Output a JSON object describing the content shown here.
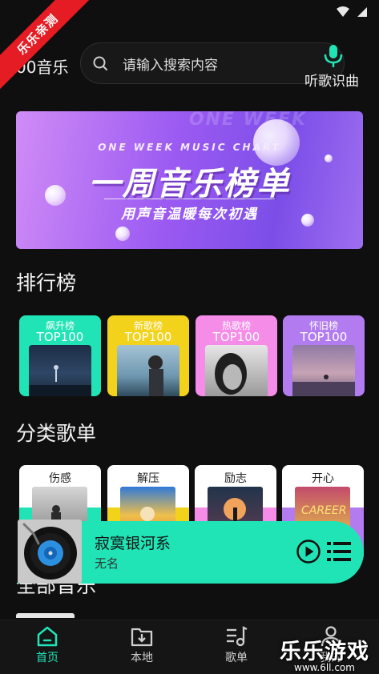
{
  "watermark": {
    "corner_ribbon": "乐乐亲测",
    "brand": "乐乐游戏",
    "url": "www.6ll.com"
  },
  "header": {
    "app_name": "00音乐",
    "search_placeholder": "请输入搜索内容",
    "recognize_label": "听歌识曲"
  },
  "banner": {
    "ghost_text": "ONE WEEK",
    "english_title": "ONE WEEK MUSIC CHART",
    "title": "一周音乐榜单",
    "subtitle": "用声音温暖每次初遇"
  },
  "rankings": {
    "title": "排行榜",
    "items": [
      {
        "name": "飙升榜",
        "tag": "TOP100",
        "color": "#21e4b6"
      },
      {
        "name": "新歌榜",
        "tag": "TOP100",
        "color": "#f3d21b"
      },
      {
        "name": "热歌榜",
        "tag": "TOP100",
        "color": "#f48ce8"
      },
      {
        "name": "怀旧榜",
        "tag": "TOP100",
        "color": "#b27cf0"
      }
    ]
  },
  "categories": {
    "title": "分类歌单",
    "items": [
      {
        "name": "伤感",
        "color": "#21e4b6"
      },
      {
        "name": "解压",
        "color": "#f3d21b"
      },
      {
        "name": "励志",
        "color": "#f48ce8"
      },
      {
        "name": "开心",
        "color": "#b27cf0"
      }
    ]
  },
  "all_music": {
    "title": "全部音乐"
  },
  "player": {
    "song": "寂寞银河系",
    "artist": "无名"
  },
  "nav": {
    "items": [
      {
        "label": "首页",
        "icon": "home-icon",
        "active": true
      },
      {
        "label": "本地",
        "icon": "folder-download-icon",
        "active": false
      },
      {
        "label": "歌单",
        "icon": "playlist-icon",
        "active": false
      },
      {
        "label": "我的",
        "icon": "user-icon",
        "active": false
      }
    ]
  },
  "colors": {
    "accent": "#21e4b6",
    "background": "#0f0f0f"
  }
}
